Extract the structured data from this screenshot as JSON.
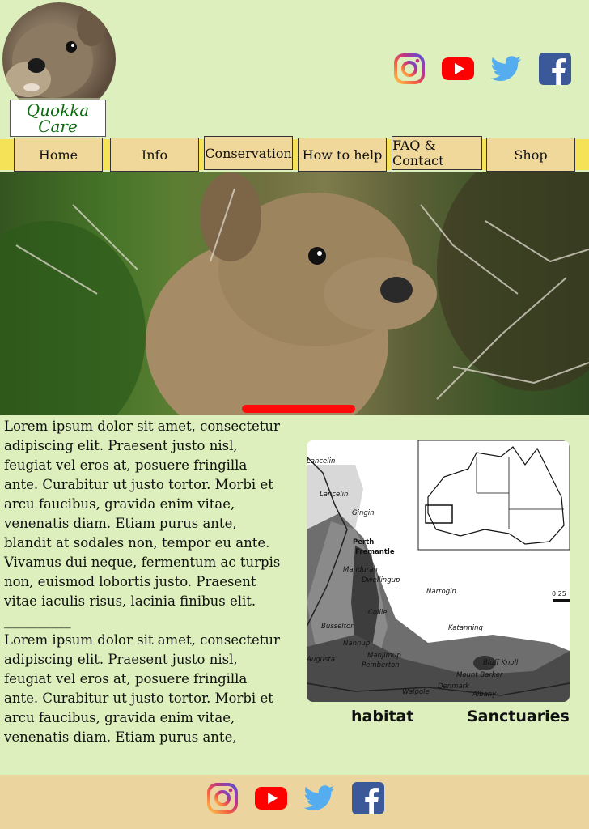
{
  "brand": {
    "name": "Quokka Care"
  },
  "nav": {
    "items": [
      {
        "label": "Home"
      },
      {
        "label": "Info"
      },
      {
        "label": "Conservation"
      },
      {
        "label": "How to help"
      },
      {
        "label": "FAQ & Contact"
      },
      {
        "label": "Shop"
      }
    ]
  },
  "social": {
    "icons": [
      "instagram-icon",
      "youtube-icon",
      "twitter-icon",
      "facebook-icon"
    ]
  },
  "colors": {
    "background": "#dcefbc",
    "navbar": "#f6e257",
    "nav_button": "#f0d79a",
    "footer": "#ecd49e",
    "slider": "#ff0a0a",
    "logo_text": "#0e6b0e"
  },
  "main": {
    "paragraph1": "Lorem ipsum dolor sit amet, consectetur adipiscing elit. Praesent justo nisl, feugiat vel eros at, posuere fringilla ante. Curabitur ut justo tortor. Morbi et arcu faucibus, gravida enim vitae, venenatis diam. Etiam purus ante, blandit at sodales non, tempor eu ante. Vivamus dui neque, fermentum ac turpis non, euismod lobortis justo. Praesent vitae iaculis risus, lacinia finibus elit.",
    "divider": "__________",
    "paragraph2": "Lorem ipsum dolor sit amet, consectetur adipiscing elit. Praesent justo nisl, feugiat vel eros at, posuere fringilla ante. Curabitur ut justo tortor. Morbi et arcu faucibus, gravida enim vitae, venenatis diam. Etiam purus ante,"
  },
  "map": {
    "places": [
      "Lancelin",
      "Gingin",
      "Perth",
      "Fremantle",
      "Mandurah",
      "Dwellingup",
      "Narrogin",
      "Collie",
      "Busselton",
      "Katanning",
      "Nannup",
      "Manjimup",
      "Augusta",
      "Pemberton",
      "Bluff Knoll",
      "Mount Barker",
      "Denmark",
      "Walpole",
      "Albany"
    ],
    "scale_label": "0  25",
    "captions": {
      "left": "habitat",
      "right": "Sanctuaries"
    }
  }
}
